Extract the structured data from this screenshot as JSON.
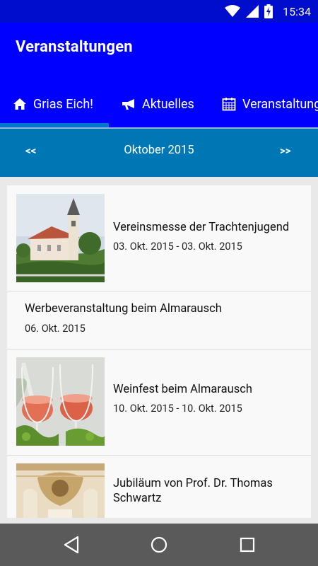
{
  "status": {
    "time": "15:34"
  },
  "app": {
    "title": "Veranstaltungen"
  },
  "tabs": [
    {
      "label": "Grias Eich!",
      "icon": "home-icon"
    },
    {
      "label": "Aktuelles",
      "icon": "megaphone-icon"
    },
    {
      "label": "Veranstaltungen",
      "icon": "calendar-icon"
    }
  ],
  "month_nav": {
    "prev": "<<",
    "month": "Oktober 2015",
    "next": ">>"
  },
  "events": [
    {
      "title": "Vereinsmesse der Trachtenjugend",
      "date": "03. Okt. 2015 - 03. Okt. 2015",
      "image": "church-photo"
    },
    {
      "title": "Werbeveranstaltung beim Almarausch",
      "date": "06. Okt. 2015",
      "image": ""
    },
    {
      "title": "Weinfest beim Almarausch",
      "date": "10. Okt. 2015 - 10. Okt. 2015",
      "image": "wine-glasses-photo"
    },
    {
      "title_line1": "Jubiläum von Prof. Dr. Thomas",
      "title_line2": "Schwartz",
      "image": "baroque-ceiling-photo"
    }
  ]
}
